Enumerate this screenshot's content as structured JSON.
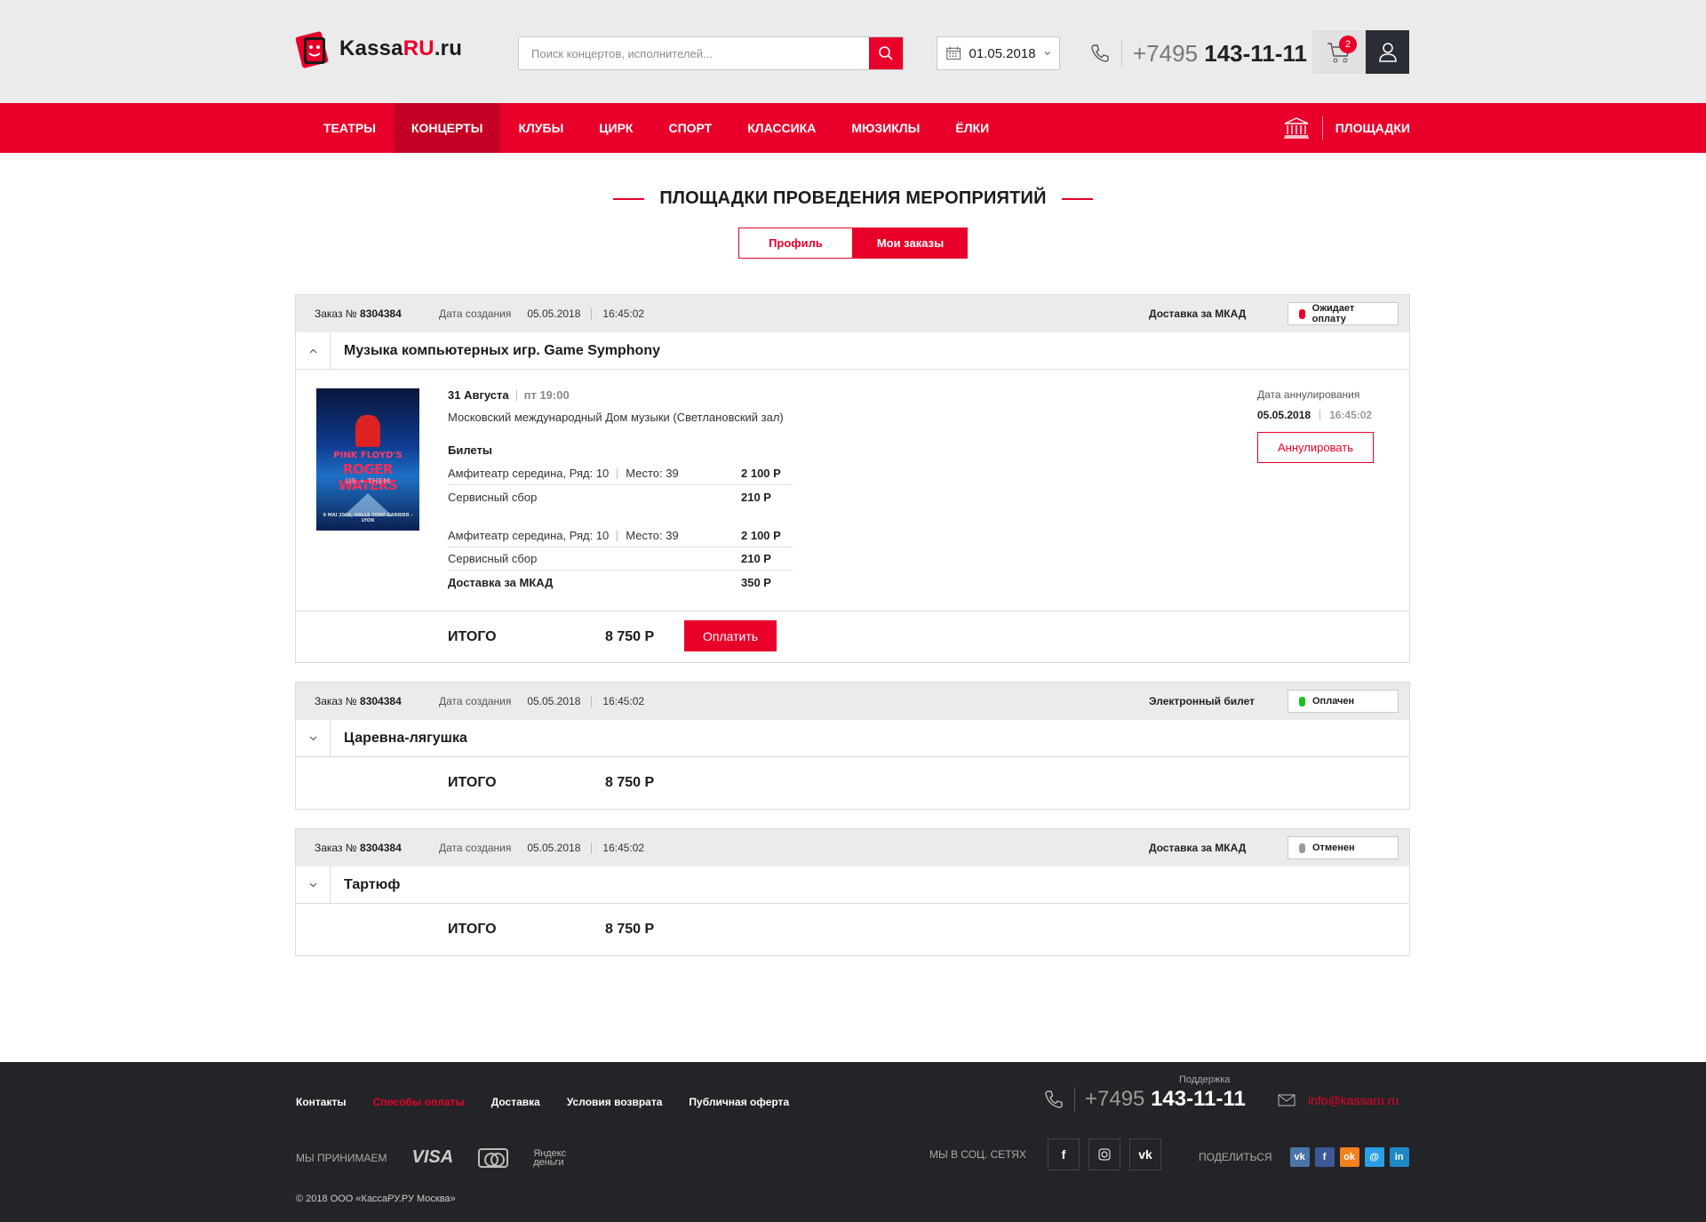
{
  "header": {
    "logo_text_main": "Kassa",
    "logo_text_accent": "RU",
    "logo_text_suffix": ".ru",
    "search_placeholder": "Поиск концертов, исполнителей...",
    "date": "01.05.2018",
    "phone_prefix": "+7495",
    "phone_number": "143-11-11",
    "cart_count": "2"
  },
  "nav": {
    "items": [
      "Театры",
      "Концерты",
      "Клубы",
      "Цирк",
      "Спорт",
      "Классика",
      "Мюзиклы",
      "Ёлки"
    ],
    "active_index": 1,
    "venues_label": "Площадки"
  },
  "page": {
    "title": "Площадки проведения мероприятий",
    "tabs": [
      "Профиль",
      "Мои заказы"
    ],
    "active_tab": 1
  },
  "orders": [
    {
      "number_label": "Заказ №",
      "number": "8304384",
      "created_label": "Дата создания",
      "created_date": "05.05.2018",
      "created_time": "16:45:02",
      "delivery": "Доставка за МКАД",
      "status": "Ожидает оплату",
      "status_color": "#e8002a",
      "name": "Музыка компьютерных игр. Game Symphony",
      "expanded": true,
      "poster": {
        "line1": "PINK FLOYD'S",
        "line2": "ROGER WATERS",
        "line3": "US + THEM",
        "line4": "9 MAI 2018, HALLE TONY GARNIER - LYON"
      },
      "event_date": "31 Августа",
      "event_time": "пт 19:00",
      "place": "Московский международный Дом музыки (Светлановский зал)",
      "tickets_title": "Билеты",
      "lines": [
        {
          "label": "Амфитеатр середина, Ряд: 10",
          "seat": "Место: 39",
          "price": "2 100 Р"
        },
        {
          "label": "Сервисный сбор",
          "price": "210 Р"
        },
        {
          "label": "Амфитеатр середина, Ряд: 10",
          "seat": "Место: 39",
          "price": "2 100 Р"
        },
        {
          "label": "Сервисный сбор",
          "price": "210 Р"
        },
        {
          "label": "Доставка за МКАД",
          "price": "350 Р"
        }
      ],
      "cancel_label": "Дата аннулирования",
      "cancel_date": "05.05.2018",
      "cancel_time": "16:45:02",
      "cancel_button": "Аннулировать",
      "total_label": "ИТОГО",
      "total": "8 750 Р",
      "pay_button": "Оплатить"
    },
    {
      "number_label": "Заказ №",
      "number": "8304384",
      "created_label": "Дата создания",
      "created_date": "05.05.2018",
      "created_time": "16:45:02",
      "delivery": "Электронный билет",
      "status": "Оплачен",
      "status_color": "#19c31f",
      "name": "Царевна-лягушка",
      "expanded": false,
      "total_label": "ИТОГО",
      "total": "8 750 Р"
    },
    {
      "number_label": "Заказ №",
      "number": "8304384",
      "created_label": "Дата создания",
      "created_date": "05.05.2018",
      "created_time": "16:45:02",
      "delivery": "Доставка за МКАД",
      "status": "Отменен",
      "status_color": "#9a9a9a",
      "name": "Тартюф",
      "expanded": false,
      "total_label": "ИТОГО",
      "total": "8 750 Р"
    }
  ],
  "footer": {
    "links": [
      "Контакты",
      "Способы оплаты",
      "Доставка",
      "Условия возврата",
      "Публичная оферта"
    ],
    "support_label": "Поддержка",
    "phone_prefix": "+7495",
    "phone_number": "143-11-11",
    "email": "info@kassaru.ru",
    "accept_label": "МЫ ПРИНИМАЕМ",
    "payment_visa": "VISA",
    "payment_mastercard_text": "MasterCard",
    "payment_ym_line1": "Яндекс",
    "payment_ym_line2": "деньги",
    "social_label": "МЫ В СОЦ. СЕТЯХ",
    "share_label": "ПОДЕЛИТЬСЯ",
    "copyright": "© 2018 ООО «КассаРУ.РУ Москва»"
  }
}
